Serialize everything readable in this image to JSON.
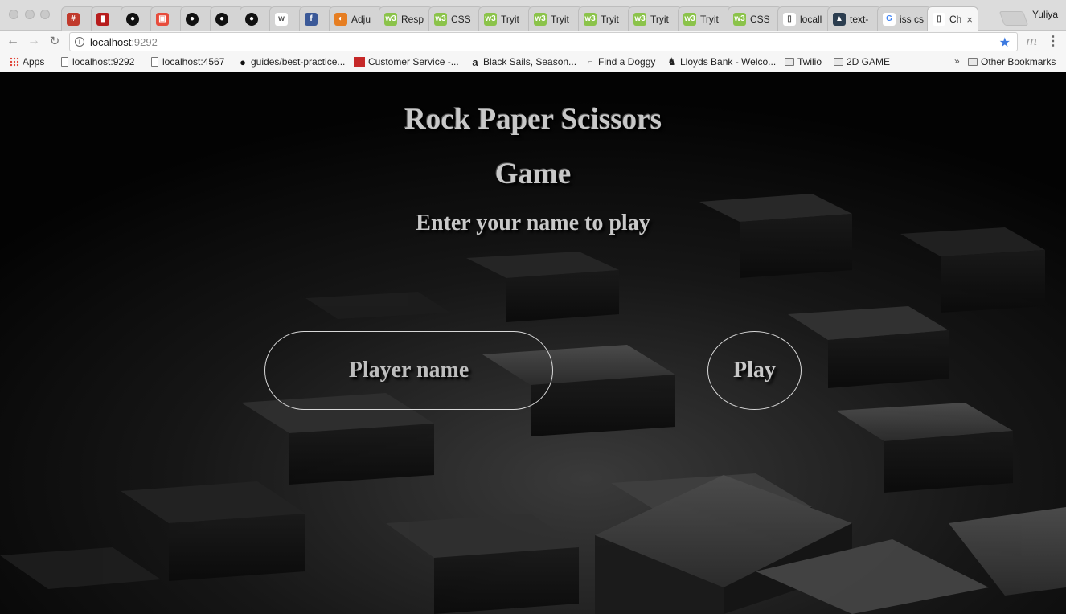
{
  "browser": {
    "tabs": [
      {
        "label": "",
        "icon": "hashtag-icon",
        "color": "#c0392b"
      },
      {
        "label": "",
        "icon": "book-icon",
        "color": "#b71c1c"
      },
      {
        "label": "",
        "icon": "github-icon",
        "color": "#111111"
      },
      {
        "label": "",
        "icon": "slides-icon",
        "color": "#e74c3c"
      },
      {
        "label": "",
        "icon": "github-icon",
        "color": "#111111"
      },
      {
        "label": "",
        "icon": "github-icon",
        "color": "#111111"
      },
      {
        "label": "",
        "icon": "github-icon",
        "color": "#111111"
      },
      {
        "label": "",
        "icon": "wr-icon",
        "color": "#ffffff"
      },
      {
        "label": "",
        "icon": "facebook-icon",
        "color": "#3b5998"
      },
      {
        "label": "Adju",
        "icon": "adjust-icon",
        "color": "#e67e22"
      },
      {
        "label": "Resp",
        "icon": "w3-icon",
        "color": "#8bc34a"
      },
      {
        "label": "CSS",
        "icon": "w3-icon",
        "color": "#8bc34a"
      },
      {
        "label": "Tryit",
        "icon": "w3-icon",
        "color": "#8bc34a"
      },
      {
        "label": "Tryit",
        "icon": "w3-icon",
        "color": "#8bc34a"
      },
      {
        "label": "Tryit",
        "icon": "w3-icon",
        "color": "#8bc34a"
      },
      {
        "label": "Tryit",
        "icon": "w3-icon",
        "color": "#8bc34a"
      },
      {
        "label": "Tryit",
        "icon": "w3-icon",
        "color": "#8bc34a"
      },
      {
        "label": "CSS",
        "icon": "w3-icon",
        "color": "#8bc34a"
      },
      {
        "label": "locall",
        "icon": "document-icon",
        "color": "#ffffff"
      },
      {
        "label": "text-",
        "icon": "graduation-cap-icon",
        "color": "#2c3e50"
      },
      {
        "label": "iss cs",
        "icon": "google-icon",
        "color": "#ffffff"
      },
      {
        "label": "Ch",
        "icon": "document-icon",
        "color": "#ffffff",
        "active": true
      }
    ],
    "close_glyph": "×",
    "profile": "Yuliya",
    "url_host": "localhost",
    "url_port": ":9292",
    "star_glyph": "★",
    "ext_label": "m",
    "bookmarks": [
      {
        "label": "Apps",
        "icon": "apps-grid-icon"
      },
      {
        "label": "localhost:9292",
        "icon": "document-icon"
      },
      {
        "label": "localhost:4567",
        "icon": "document-icon"
      },
      {
        "label": "guides/best-practice...",
        "icon": "github-icon"
      },
      {
        "label": "Customer Service -...",
        "icon": "store-icon"
      },
      {
        "label": "Black Sails, Season...",
        "icon": "amazon-icon"
      },
      {
        "label": "Find a Doggy",
        "icon": "dog-icon"
      },
      {
        "label": "Lloyds Bank - Welco...",
        "icon": "horse-icon"
      },
      {
        "label": "Twilio",
        "icon": "folder-icon"
      },
      {
        "label": "2D GAME",
        "icon": "folder-icon"
      }
    ],
    "overflow_chevron": "»",
    "other_bookmarks": "Other Bookmarks"
  },
  "page": {
    "title_line1": "Rock Paper Scissors",
    "title_line2": "Game",
    "subtitle": "Enter your name to play",
    "name_placeholder": "Player name",
    "play_label": "Play"
  },
  "colors": {
    "page_background": "#050505",
    "text": "#c8c8c8",
    "control_border": "#d8d8d8",
    "bookmark_star": "#3d7ae0"
  }
}
